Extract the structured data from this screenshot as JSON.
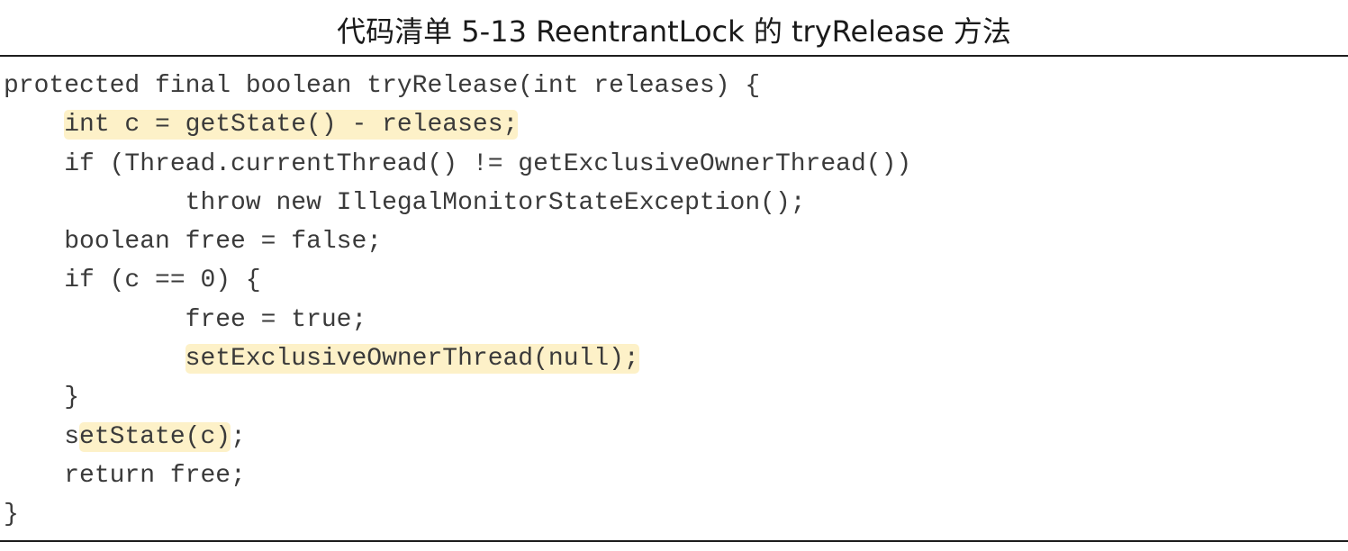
{
  "listing": {
    "caption": "代码清单 5-13   ReentrantLock 的 tryRelease 方法",
    "code": [
      {
        "indent": "",
        "pre": "protected final boolean tryRelease(int releases) {",
        "highlight": "",
        "post": ""
      },
      {
        "indent": "    ",
        "pre": "",
        "highlight": "int c = getState() - releases;",
        "post": ""
      },
      {
        "indent": "    ",
        "pre": "if (Thread.currentThread() != getExclusiveOwnerThread())",
        "highlight": "",
        "post": ""
      },
      {
        "indent": "            ",
        "pre": "throw new IllegalMonitorStateException();",
        "highlight": "",
        "post": ""
      },
      {
        "indent": "    ",
        "pre": "boolean free = false;",
        "highlight": "",
        "post": ""
      },
      {
        "indent": "    ",
        "pre": "if (c == 0) {",
        "highlight": "",
        "post": ""
      },
      {
        "indent": "            ",
        "pre": "free = true;",
        "highlight": "",
        "post": ""
      },
      {
        "indent": "            ",
        "pre": "",
        "highlight": "setExclusiveOwnerThread(null);",
        "post": ""
      },
      {
        "indent": "    ",
        "pre": "}",
        "highlight": "",
        "post": ""
      },
      {
        "indent": "    ",
        "pre": "s",
        "highlight": "etState(c)",
        "post": ";"
      },
      {
        "indent": "    ",
        "pre": "return free;",
        "highlight": "",
        "post": ""
      },
      {
        "indent": "",
        "pre": "}",
        "highlight": "",
        "post": ""
      }
    ],
    "colors": {
      "text": "#3a3a3a",
      "highlight": "#fdf1c8",
      "rule": "#1e1e1e"
    }
  }
}
